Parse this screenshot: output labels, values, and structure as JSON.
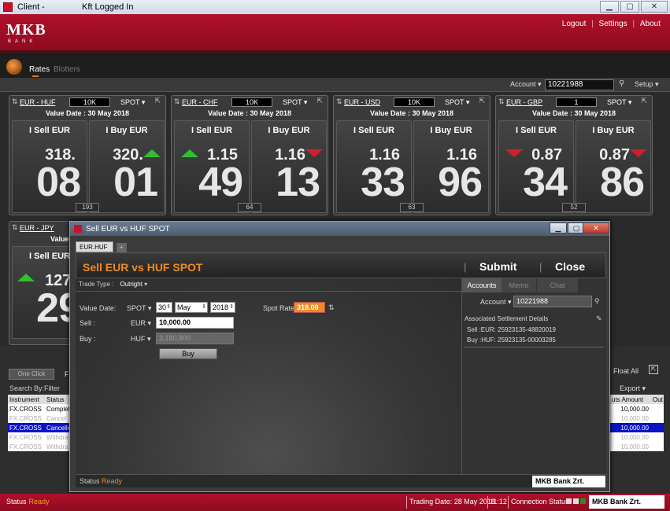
{
  "window": {
    "title": "Client -",
    "user": "Kft Logged In",
    "btn_min": "▁",
    "btn_max": "▢",
    "btn_close": "✕"
  },
  "brand": {
    "logo": "MKB",
    "sub": "BANK",
    "accent": "#a40e25",
    "orange": "#f08a22"
  },
  "toplinks": {
    "logout": "Logout",
    "sep": "|",
    "settings": "Settings",
    "about": "About"
  },
  "nav": {
    "rates": "Rates",
    "blotters": "Blotters"
  },
  "account_bar": {
    "label": "Account",
    "value": "10221988",
    "setup": "Setup"
  },
  "tiles": [
    {
      "pair": "EUR - HUF",
      "amount": "10K",
      "type": "SPOT",
      "value_date": "Value Date : 30 May 2018",
      "sell_label": "I Sell EUR",
      "buy_label": "I Buy EUR",
      "sell_big": "318.",
      "sell_pips": "08",
      "buy_big": "320.",
      "buy_pips": "01",
      "sell_arrow": "",
      "buy_arrow": "up",
      "spread": "193"
    },
    {
      "pair": "EUR - CHF",
      "amount": "10K",
      "type": "SPOT",
      "value_date": "Value Date : 30 May 2018",
      "sell_label": "I Sell EUR",
      "buy_label": "I Buy EUR",
      "sell_big": "1.15",
      "sell_pips": "49",
      "buy_big": "1.16",
      "buy_pips": "13",
      "sell_arrow": "up",
      "buy_arrow": "down",
      "spread": "64"
    },
    {
      "pair": "EUR - USD",
      "amount": "10K",
      "type": "SPOT",
      "value_date": "Value Date : 30 May 2018",
      "sell_label": "I Sell EUR",
      "buy_label": "I Buy EUR",
      "sell_big": "1.16",
      "sell_pips": "33",
      "buy_big": "1.16",
      "buy_pips": "96",
      "sell_arrow": "",
      "buy_arrow": "",
      "spread": "63"
    },
    {
      "pair": "EUR - GBP",
      "amount": "1",
      "type": "SPOT",
      "value_date": "Value Date : 30 May 2018",
      "sell_label": "I Sell EUR",
      "buy_label": "I Buy EUR",
      "sell_big": "0.87",
      "sell_pips": "34",
      "buy_big": "0.87",
      "buy_pips": "86",
      "sell_arrow": "down",
      "buy_arrow": "down",
      "spread": "52"
    }
  ],
  "tile5": {
    "pair": "EUR - JPY",
    "value_frag": "Value",
    "sell_label": "I Sell EUR",
    "sell_big": "127.",
    "sell_pips": "29"
  },
  "lower": {
    "one_click": "One Click",
    "f_frag": "F",
    "float_all": "Float All",
    "search_by": "Search By:",
    "filter": "Filter",
    "export": "Export",
    "col_instrument": "Instrument",
    "col_status": "Status",
    "col_amount": "uts Amount",
    "col_out": "Out",
    "rows": [
      {
        "instrument": "FX.CROSS",
        "status": "Complet",
        "amount": "10,000.00"
      },
      {
        "instrument": "FX.CROSS",
        "status": "Cancel",
        "amount": "10,000.00"
      },
      {
        "instrument": "FX.CROSS",
        "status": "Cancelle",
        "amount": "10,000.00"
      },
      {
        "instrument": "FX.CROSS",
        "status": "Withdra",
        "amount": "10,000.00"
      },
      {
        "instrument": "FX.CROSS",
        "status": "Withdra",
        "amount": "10,000.00"
      }
    ]
  },
  "dialog": {
    "title": "Sell EUR vs HUF SPOT",
    "tab": "EUR.HUF",
    "tab_close": "×",
    "tab_add": "+",
    "heading": "Sell EUR vs HUF SPOT",
    "submit": "Submit",
    "close": "Close",
    "trade_type_label": "Trade Type :",
    "trade_type": "Outright",
    "value_date_label": "Value Date:",
    "spot": "SPOT",
    "day": "30",
    "month": "May",
    "year": "2018",
    "spot_rate_label": "Spot Rate:",
    "spot_rate": "318.08",
    "sell_label": "Sell :",
    "sell_ccy": "EUR",
    "sell_amount": "10,000.00",
    "buy_label": "Buy :",
    "buy_ccy": "HUF",
    "buy_amount": "3,180,800",
    "buy_button": "Buy",
    "tabs": {
      "accounts": "Accounts",
      "memo": "Memo",
      "chat": "Chat"
    },
    "account_label": "Account",
    "account_value": "10221988",
    "settlement_title": "Associated Settlement Details",
    "settle_sell": "Sell :EUR: 25923135-48820019",
    "settle_buy": "Buy :HUF: 25923135-00003285",
    "status_label": "Status",
    "status_value": "Ready",
    "bank": "MKB Bank Zrt."
  },
  "statusbar": {
    "status_label": "Status",
    "status_value": "Ready",
    "trading_date": "Trading Date: 28 May 2018",
    "time": "11:12",
    "connection": "Connection Status",
    "bank": "MKB Bank Zrt."
  }
}
